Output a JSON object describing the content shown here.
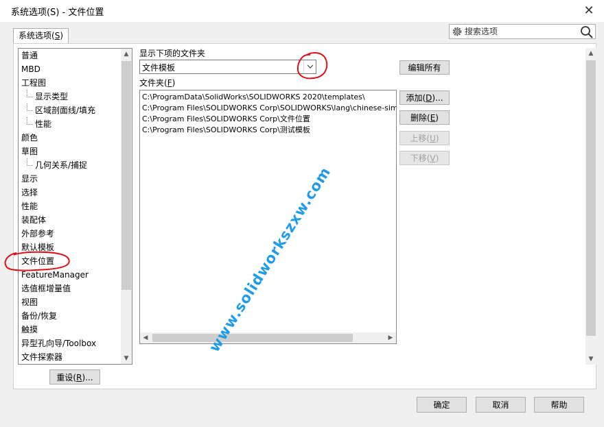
{
  "window": {
    "title": "系统选项(S) - 文件位置",
    "close_glyph": "✕"
  },
  "tab": {
    "label_main": "系统选项(",
    "label_key": "S",
    "label_end": ")"
  },
  "search": {
    "placeholder": "搜索选项"
  },
  "tree": {
    "items": [
      {
        "label": "普通",
        "child": false
      },
      {
        "label": "MBD",
        "child": false
      },
      {
        "label": "工程图",
        "child": false
      },
      {
        "label": "显示类型",
        "child": true
      },
      {
        "label": "区域剖面线/填充",
        "child": true
      },
      {
        "label": "性能",
        "child": true
      },
      {
        "label": "颜色",
        "child": false
      },
      {
        "label": "草图",
        "child": false
      },
      {
        "label": "几何关系/捕捉",
        "child": true
      },
      {
        "label": "显示",
        "child": false
      },
      {
        "label": "选择",
        "child": false
      },
      {
        "label": "性能",
        "child": false
      },
      {
        "label": "装配体",
        "child": false
      },
      {
        "label": "外部参考",
        "child": false
      },
      {
        "label": "默认模板",
        "child": false
      },
      {
        "label": "文件位置",
        "child": false,
        "selected": true
      },
      {
        "label": "FeatureManager",
        "child": false
      },
      {
        "label": "选值框增量值",
        "child": false
      },
      {
        "label": "视图",
        "child": false
      },
      {
        "label": "备份/恢复",
        "child": false
      },
      {
        "label": "触摸",
        "child": false
      },
      {
        "label": "异型孔向导/Toolbox",
        "child": false
      },
      {
        "label": "文件探索器",
        "child": false
      }
    ]
  },
  "reset_button": {
    "main": "重设(",
    "key": "R",
    "end": ")..."
  },
  "show_folders_for": {
    "label": "显示下项的文件夹",
    "value": "文件模板"
  },
  "folders": {
    "label_main": "文件夹(",
    "label_key": "F",
    "label_end": ")",
    "items": [
      "C:\\ProgramData\\SolidWorks\\SOLIDWORKS 2020\\templates\\",
      "C:\\Program Files\\SOLIDWORKS Corp\\SOLIDWORKS\\lang\\chinese-simplified",
      "C:\\Program Files\\SOLIDWORKS Corp\\文件位置",
      "C:\\Program Files\\SOLIDWORKS Corp\\测试模板"
    ]
  },
  "buttons": {
    "edit_all": "编辑所有",
    "add": {
      "main": "添加(",
      "key": "D",
      "end": ")..."
    },
    "delete": {
      "main": "删除(",
      "key": "E",
      "end": ")"
    },
    "move_up": {
      "main": "上移(",
      "key": "U",
      "end": ")"
    },
    "move_down": {
      "main": "下移(",
      "key": "V",
      "end": ")"
    },
    "ok": "确定",
    "cancel": "取消",
    "help": "帮助"
  },
  "watermark": "www.solidworkszxw.com",
  "colors": {
    "annotation": "#e0101a",
    "watermark": "#1f9be8",
    "selection_bg": "#ffffff"
  }
}
